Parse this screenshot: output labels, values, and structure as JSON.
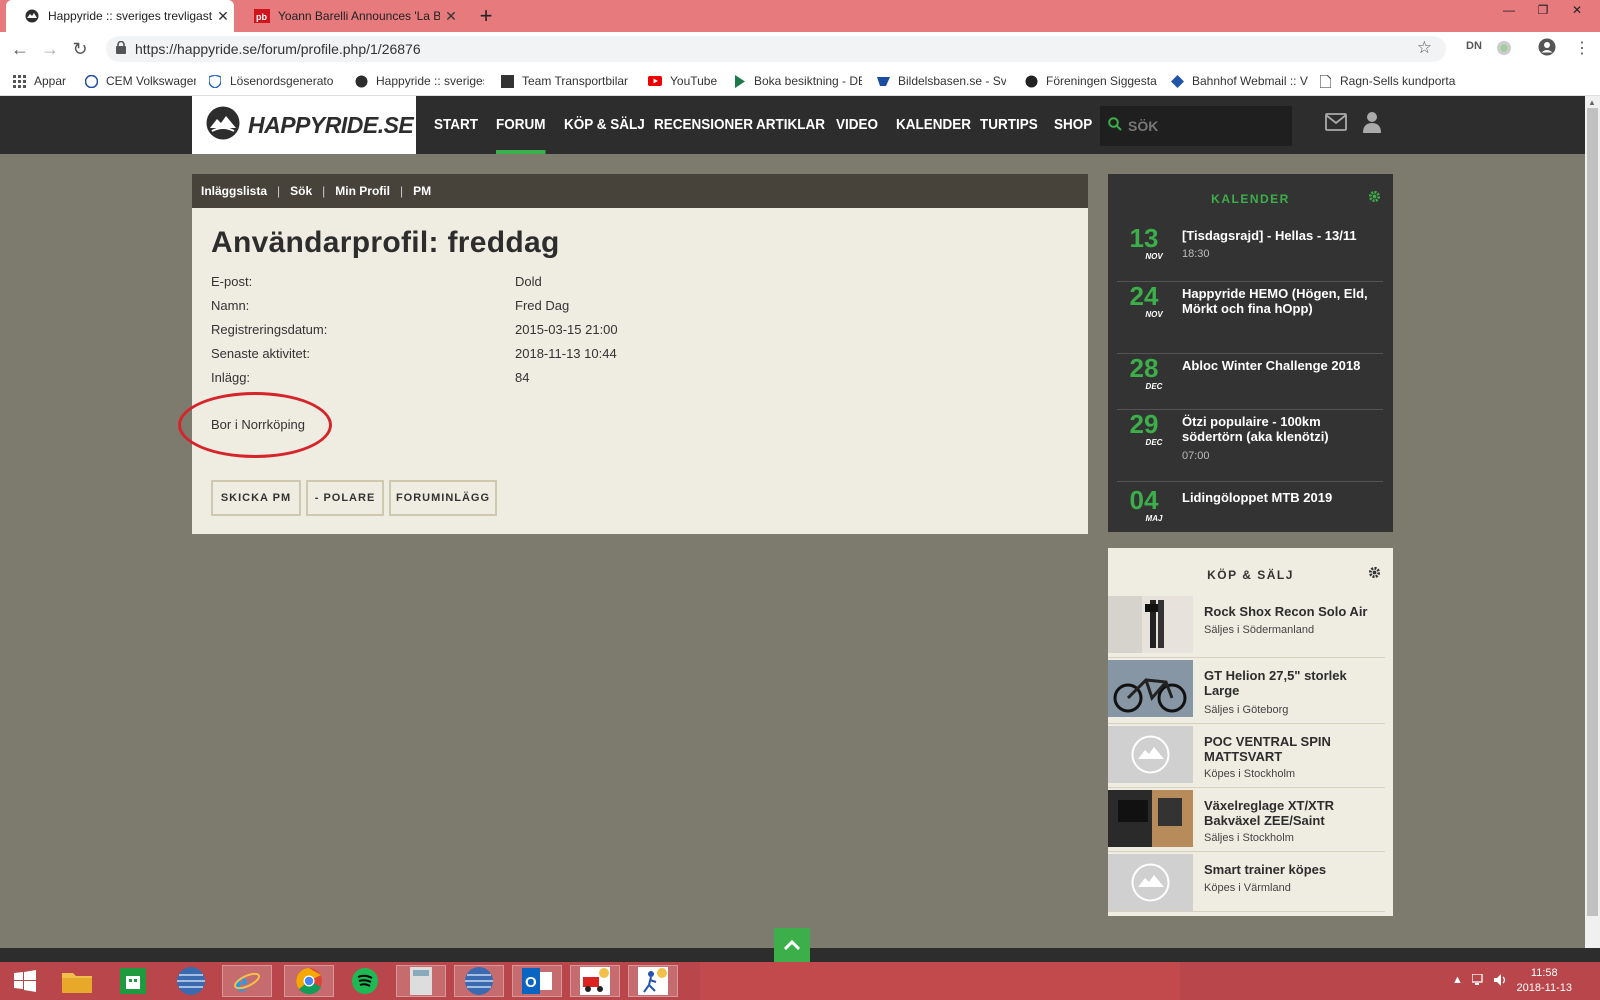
{
  "browser": {
    "tabs": [
      {
        "title": "Happyride :: sveriges trevligaste c",
        "active": true
      },
      {
        "title": "Yoann Barelli Announces 'La Bag",
        "active": false
      }
    ],
    "newtab": "+",
    "url": "https://happyride.se/forum/profile.php/1/26876",
    "ext1": "DN",
    "bookmarks": [
      "Appar",
      "CEM Volkswagen",
      "Lösenordsgenerator",
      "Happyride :: sveriges",
      "Team Transportbilar",
      "YouTube",
      "Boka besiktning - DE",
      "Bildelsbasen.se - Sve",
      "Föreningen Siggesta",
      "Bahnhof Webmail :: V",
      "Ragn-Sells kundporta"
    ]
  },
  "site": {
    "logo": "HAPPYRIDE.SE",
    "nav": [
      "START",
      "FORUM",
      "KÖP & SÄLJ",
      "RECENSIONER",
      "ARTIKLAR",
      "VIDEO",
      "KALENDER",
      "TURTIPS",
      "SHOP"
    ],
    "active_nav": "FORUM",
    "search_placeholder": "SÖK"
  },
  "breadcrumb": [
    "Inläggslista",
    "Sök",
    "Min Profil",
    "PM"
  ],
  "profile": {
    "title": "Användarprofil: freddag",
    "fields": [
      {
        "label": "E-post:",
        "value": "Dold"
      },
      {
        "label": "Namn:",
        "value": "Fred Dag"
      },
      {
        "label": "Registreringsdatum:",
        "value": "2015-03-15 21:00"
      },
      {
        "label": "Senaste aktivitet:",
        "value": "2018-11-13 10:44"
      },
      {
        "label": "Inlägg:",
        "value": "84"
      }
    ],
    "bio": "Bor i Norrköping",
    "buttons": [
      "SKICKA PM",
      "- POLARE",
      "FORUMINLÄGG"
    ]
  },
  "kalender": {
    "title": "KALENDER",
    "events": [
      {
        "day": "13",
        "month": "NOV",
        "title": "[Tisdagsrajd] - Hellas - 13/11",
        "time": "18:30"
      },
      {
        "day": "24",
        "month": "NOV",
        "title": "Happyride HEMO (Högen, Eld, Mörkt och fina hOpp)",
        "time": ""
      },
      {
        "day": "28",
        "month": "DEC",
        "title": "Abloc Winter Challenge 2018",
        "time": ""
      },
      {
        "day": "29",
        "month": "DEC",
        "title": "Ötzi populaire - 100km södertörn (aka klenötzi)",
        "time": "07:00"
      },
      {
        "day": "04",
        "month": "MAJ",
        "title": "Lidingöloppet MTB 2019",
        "time": ""
      }
    ]
  },
  "kop_salj": {
    "title": "KÖP & SÄLJ",
    "items": [
      {
        "title": "Rock Shox Recon Solo Air",
        "sub": "Säljes i Södermanland",
        "thumb": "fork-photo"
      },
      {
        "title": "GT Helion 27,5\" storlek Large",
        "sub": "Säljes i Göteborg",
        "thumb": "bike-photo"
      },
      {
        "title": "POC VENTRAL SPIN MATTSVART",
        "sub": "Köpes i Stockholm",
        "thumb": "placeholder-logo"
      },
      {
        "title": "Växelreglage XT/XTR Bakväxel ZEE/Saint",
        "sub": "Säljes i Stockholm",
        "thumb": "parts-photo"
      },
      {
        "title": "Smart trainer köpes",
        "sub": "Köpes i Värmland",
        "thumb": "placeholder-logo"
      }
    ]
  },
  "taskbar": {
    "time": "11:58",
    "date": "2018-11-13"
  },
  "colors": {
    "accent": "#3cae4a",
    "header_bg": "#2d2d2d",
    "page_bg": "#7d7a6e",
    "panel_bg": "#efede1",
    "tabbar": "#e77a7c",
    "annotation": "#d6242b"
  }
}
